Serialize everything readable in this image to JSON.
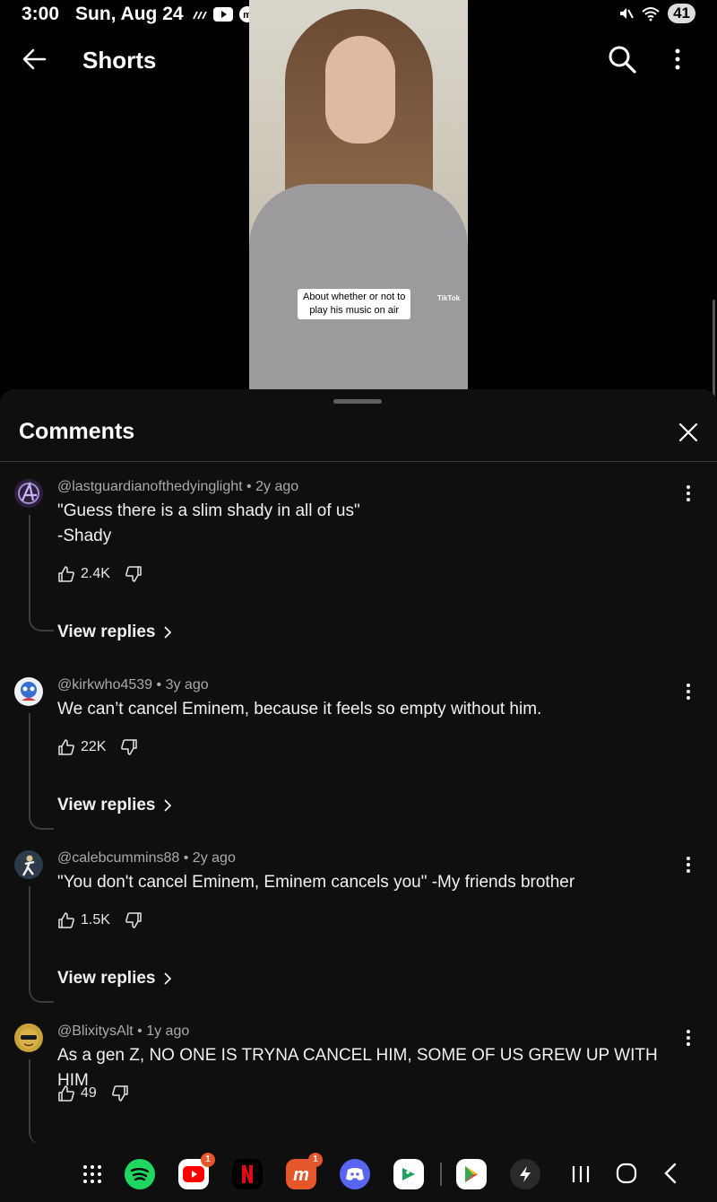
{
  "status": {
    "time": "3:00",
    "date": "Sun, Aug 24",
    "battery": "41"
  },
  "header": {
    "title": "Shorts"
  },
  "video": {
    "caption": "About whether or not to\nplay his music on air",
    "watermark": "TikTok"
  },
  "comments": {
    "title": "Comments",
    "view_replies_label": "View replies",
    "items": [
      {
        "handle": "@lastguardianofthedyinglight",
        "age": "2y ago",
        "text": "\"Guess there is a slim shady in all of us\"\n-Shady",
        "likes": "2.4K",
        "has_replies": true,
        "avatar_color": "#2c1f3d"
      },
      {
        "handle": "@kirkwho4539",
        "age": "3y ago",
        "text": "We can’t cancel Eminem, because it feels so empty without him.",
        "likes": "22K",
        "has_replies": true,
        "avatar_color": "#eef2f7"
      },
      {
        "handle": "@calebcummins88",
        "age": "2y ago",
        "text": "\"You don't cancel Eminem, Eminem cancels you\" -My friends brother",
        "likes": "1.5K",
        "has_replies": true,
        "avatar_color": "#2d3a47"
      },
      {
        "handle": "@BlixitysAlt",
        "age": "1y ago",
        "text": "As a gen Z, NO ONE IS TRYNA CANCEL HIM, SOME OF US GREW UP WITH HIM",
        "likes": "49",
        "has_replies": false,
        "avatar_color": "#c9a23a"
      }
    ]
  },
  "navbar": {
    "apps": [
      {
        "name": "app-drawer-icon",
        "color": "transparent",
        "badge": ""
      },
      {
        "name": "spotify-icon",
        "color": "#1ed760",
        "badge": ""
      },
      {
        "name": "youtube-icon",
        "color": "#ffffff",
        "badge": "1"
      },
      {
        "name": "netflix-icon",
        "color": "#000000",
        "badge": ""
      },
      {
        "name": "mastodon-icon",
        "color": "#e5562b",
        "badge": "1"
      },
      {
        "name": "discord-icon",
        "color": "#5865f2",
        "badge": ""
      },
      {
        "name": "play-games-icon",
        "color": "#ffffff",
        "badge": ""
      },
      {
        "name": "play-store-icon",
        "color": "#ffffff",
        "badge": ""
      },
      {
        "name": "lightning-app-icon",
        "color": "#2a2a2a",
        "badge": ""
      }
    ]
  },
  "colors": {
    "sheet_bg": "#0f0f0f",
    "accent_text": "#f1f1f1",
    "meta_text": "#aaaaaa"
  }
}
